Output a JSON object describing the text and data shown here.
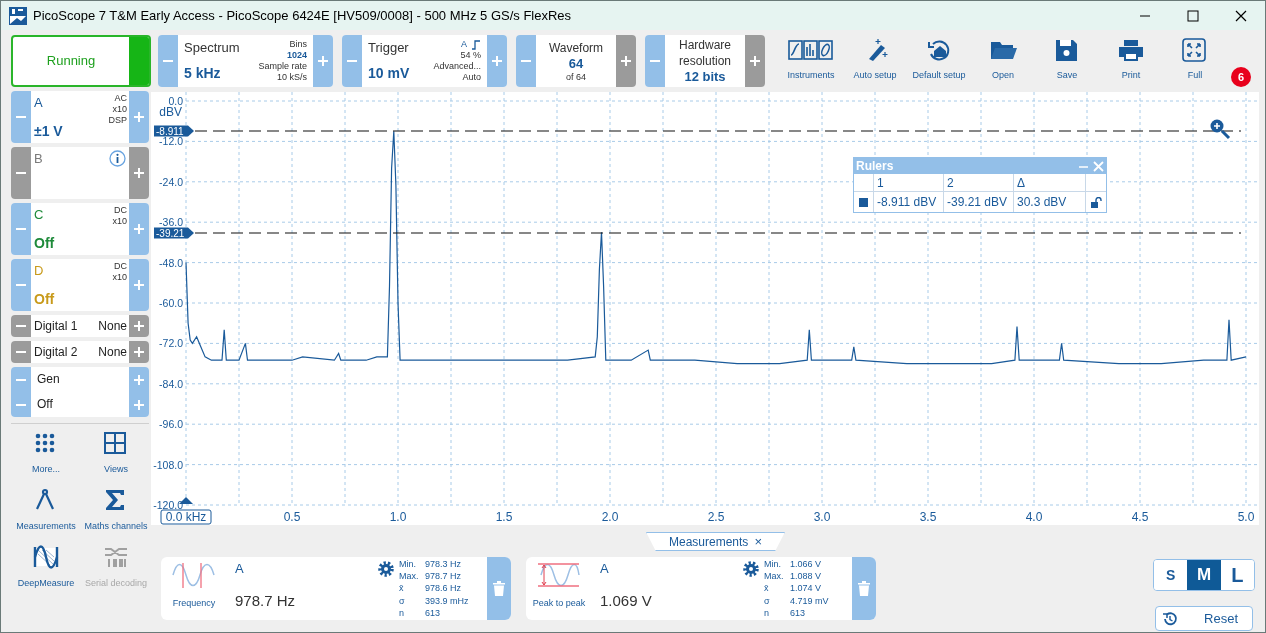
{
  "window": {
    "title": "PicoScope 7 T&M Early Access  - PicoScope 6424E [HV509/0008] - 500 MHz 5 GS/s FlexRes"
  },
  "run_button": {
    "label": "Running"
  },
  "controls": [
    {
      "kind": "split",
      "title": "Spectrum",
      "value": "5 kHz",
      "plus_enabled": true,
      "details": [
        {
          "text": "Bins",
          "bold": false
        },
        {
          "text": "1024",
          "bold": true
        },
        {
          "text": "Sample rate",
          "bold": false
        },
        {
          "text": "10 kS/s",
          "bold": false
        }
      ]
    },
    {
      "kind": "split",
      "title": "Trigger",
      "value": "10 mV",
      "channel": "A",
      "plus_enabled": true,
      "details": [
        {
          "text": "54 %",
          "bold": false
        },
        {
          "text": "Advanced...",
          "bold": false
        },
        {
          "text": "Auto",
          "bold": false
        }
      ]
    },
    {
      "kind": "centered",
      "title": "Waveform",
      "value": "64",
      "sub": "of 64",
      "plus_enabled": false
    },
    {
      "kind": "centered",
      "title": "Hardware resolution",
      "value": "12 bits",
      "plus_enabled": false
    }
  ],
  "toolbar": [
    "Instruments",
    "Auto setup",
    "Default setup",
    "Open",
    "Save",
    "Print",
    "Full"
  ],
  "notification_count": "6",
  "channels": [
    {
      "name": "A",
      "color": "#1a5a9a",
      "enabled": true,
      "range": "±1 V",
      "tags": [
        "AC",
        "x10",
        "DSP"
      ]
    },
    {
      "name": "B",
      "color": "#7a7a7a",
      "enabled": false
    },
    {
      "name": "C",
      "color": "#1e8a3a",
      "enabled": true,
      "range": "Off",
      "tags": [
        "DC",
        "x10"
      ]
    },
    {
      "name": "D",
      "color": "#c89a1a",
      "enabled": true,
      "range": "Off",
      "tags": [
        "DC",
        "x10"
      ]
    }
  ],
  "digital": [
    {
      "label": "Digital 1",
      "value": "None"
    },
    {
      "label": "Digital 2",
      "value": "None"
    }
  ],
  "generator": [
    "Gen",
    "Off"
  ],
  "tools": [
    {
      "label": "More...",
      "disabled": false
    },
    {
      "label": "Views",
      "disabled": false
    },
    {
      "label": "Measurements",
      "disabled": false
    },
    {
      "label": "Maths channels",
      "disabled": false
    },
    {
      "label": "DeepMeasure",
      "disabled": false
    },
    {
      "label": "Serial decoding",
      "disabled": true
    }
  ],
  "plot": {
    "chart_data": {
      "type": "line",
      "ylabel": "dBV",
      "xlim": [
        0,
        5
      ],
      "ylim": [
        -120,
        0
      ],
      "x": [
        0,
        0.01,
        0.02,
        0.03,
        0.05,
        0.07,
        0.09,
        0.12,
        0.17,
        0.18,
        0.19,
        0.25,
        0.28,
        0.29,
        0.4,
        0.5,
        0.55,
        0.7,
        0.72,
        0.73,
        0.85,
        0.9,
        0.95,
        0.96,
        0.97,
        0.98,
        0.99,
        1.0,
        1.01,
        1.2,
        1.4,
        1.6,
        1.8,
        1.93,
        1.94,
        1.95,
        1.96,
        1.97,
        1.98,
        2.1,
        2.18,
        2.19,
        2.4,
        2.6,
        2.8,
        2.93,
        2.94,
        2.95,
        3.14,
        3.15,
        3.16,
        3.4,
        3.6,
        3.8,
        3.91,
        3.92,
        3.93,
        4.12,
        4.13,
        4.14,
        4.4,
        4.6,
        4.8,
        4.91,
        4.92,
        4.93,
        5.0
      ],
      "series": [
        {
          "color": "#1a5a9a",
          "values": [
            -48,
            -66,
            -71,
            -72,
            -70,
            -73,
            -76,
            -77,
            -77,
            -68,
            -77,
            -77,
            -72,
            -77,
            -77,
            -77,
            -76,
            -77,
            -75,
            -77,
            -77,
            -76,
            -76,
            -55,
            -20,
            -9,
            -25,
            -60,
            -77,
            -77,
            -77,
            -77,
            -77,
            -76,
            -70,
            -50,
            -39,
            -55,
            -77,
            -77,
            -74,
            -77,
            -77,
            -78,
            -78,
            -77,
            -68,
            -77,
            -77,
            -73,
            -77,
            -78,
            -78,
            -78,
            -77,
            -67,
            -77,
            -77,
            -72,
            -77,
            -78,
            -78,
            -77,
            -77,
            -65,
            -77,
            -76
          ]
        }
      ],
      "xticks": [
        {
          "value": 0,
          "label": "0.0 kHz"
        },
        {
          "value": 0.5,
          "label": "0.5"
        },
        {
          "value": 1,
          "label": "1.0"
        },
        {
          "value": 1.5,
          "label": "1.5"
        },
        {
          "value": 2,
          "label": "2.0"
        },
        {
          "value": 2.5,
          "label": "2.5"
        },
        {
          "value": 3,
          "label": "3.0"
        },
        {
          "value": 3.5,
          "label": "3.5"
        },
        {
          "value": 4,
          "label": "4.0"
        },
        {
          "value": 4.5,
          "label": "4.5"
        },
        {
          "value": 5,
          "label": "5.0"
        }
      ],
      "yticks": [
        {
          "value": 0,
          "label": "0.0"
        },
        {
          "value": -12,
          "label": "-12.0"
        },
        {
          "value": -24,
          "label": "-24.0"
        },
        {
          "value": -36,
          "label": "-36.0"
        },
        {
          "value": -48,
          "label": "-48.0"
        },
        {
          "value": -60,
          "label": "-60.0"
        },
        {
          "value": -72,
          "label": "-72.0"
        },
        {
          "value": -84,
          "label": "-84.0"
        },
        {
          "value": -96,
          "label": "-96.0"
        },
        {
          "value": -108,
          "label": "-108.0"
        },
        {
          "value": -120,
          "label": "-120.0"
        }
      ],
      "grid": true,
      "ref_lines": [
        {
          "axis": "y",
          "value": -8.911,
          "label": "-8.911"
        },
        {
          "axis": "y",
          "value": -39.21,
          "label": "-39.21"
        }
      ]
    }
  },
  "rulers": {
    "title": "Rulers",
    "columns": [
      "1",
      "2",
      "Δ"
    ],
    "color": "#1a5a9a",
    "values": [
      "-8.911 dBV",
      "-39.21 dBV",
      "30.3 dBV"
    ]
  },
  "measurements_tab": {
    "label": "Measurements",
    "close": "×"
  },
  "measurements": [
    {
      "channel": "A",
      "name": "Frequency",
      "value": "978.7 Hz",
      "stats": [
        {
          "label": "Min.",
          "value": "978.3 Hz"
        },
        {
          "label": "Max.",
          "value": "978.7 Hz"
        },
        {
          "label": "x̄",
          "value": "978.6 Hz"
        },
        {
          "label": "σ",
          "value": "393.9 mHz"
        },
        {
          "label": "n",
          "value": "613"
        }
      ]
    },
    {
      "channel": "A",
      "name": "Peak to peak",
      "value": "1.069 V",
      "stats": [
        {
          "label": "Min.",
          "value": "1.066 V"
        },
        {
          "label": "Max.",
          "value": "1.088 V"
        },
        {
          "label": "x̄",
          "value": "1.074 V"
        },
        {
          "label": "σ",
          "value": "4.719 mV"
        },
        {
          "label": "n",
          "value": "613"
        }
      ]
    }
  ],
  "sizes": [
    {
      "label": "S",
      "selected": false
    },
    {
      "label": "M",
      "selected": true
    },
    {
      "label": "L",
      "selected": false
    }
  ],
  "reset_button": {
    "label": "Reset"
  }
}
